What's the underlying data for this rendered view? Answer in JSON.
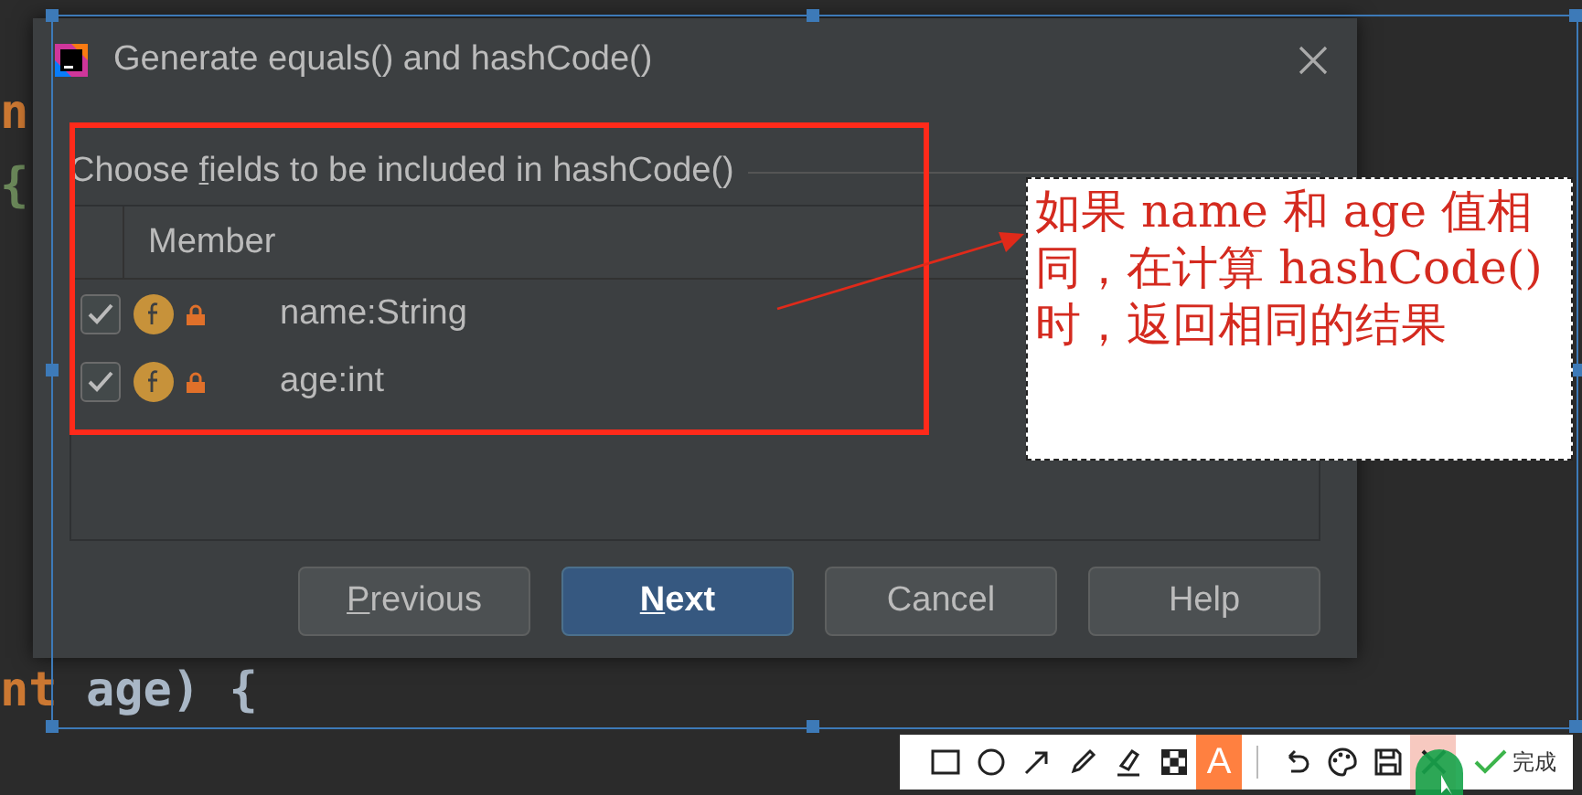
{
  "editor": {
    "lines": [
      {
        "tokens": [
          {
            "text": "n",
            "kind": "keyword"
          }
        ]
      },
      {
        "tokens": [
          {
            "text": "{",
            "kind": "brace"
          }
        ]
      },
      {
        "tokens": [
          {
            "text": "nt",
            "kind": "keyword"
          },
          {
            "text": " age) {",
            "kind": "plain"
          }
        ]
      }
    ]
  },
  "dialog": {
    "title": "Generate equals() and hashCode()",
    "prompt": {
      "parts": [
        {
          "text": "Choose ",
          "underline": false
        },
        {
          "text": "f",
          "underline": true
        },
        {
          "text": "ields to be included in hashCode()",
          "underline": false
        }
      ]
    },
    "table": {
      "columns": [
        "Member"
      ],
      "rows": [
        {
          "checked": true,
          "name": "name:String"
        },
        {
          "checked": true,
          "name": "age:int"
        }
      ]
    },
    "buttons": [
      {
        "parts": [
          {
            "text": "P",
            "underline": true
          },
          {
            "text": "revious",
            "underline": false
          }
        ],
        "default": false
      },
      {
        "parts": [
          {
            "text": "N",
            "underline": true
          },
          {
            "text": "ext",
            "underline": false
          }
        ],
        "default": true
      },
      {
        "parts": [
          {
            "text": "Cancel",
            "underline": false
          }
        ],
        "default": false
      },
      {
        "parts": [
          {
            "text": "Help",
            "underline": false
          }
        ],
        "default": false
      }
    ]
  },
  "annotation": {
    "note": "如果 name 和 age 值相同，在计算 hashCode() 时，返回相同的结果"
  },
  "toolbar": {
    "tools": [
      {
        "kind": "rectangle",
        "selected": false
      },
      {
        "kind": "ellipse",
        "selected": false
      },
      {
        "kind": "arrow",
        "selected": false
      },
      {
        "kind": "pencil",
        "selected": false
      },
      {
        "kind": "marker",
        "selected": false
      },
      {
        "kind": "mosaic",
        "selected": false
      },
      {
        "kind": "text",
        "label": "A",
        "selected": true
      }
    ],
    "actions": [
      {
        "kind": "undo"
      },
      {
        "kind": "palette"
      },
      {
        "kind": "save"
      },
      {
        "kind": "cancel"
      }
    ],
    "done": "完成"
  }
}
